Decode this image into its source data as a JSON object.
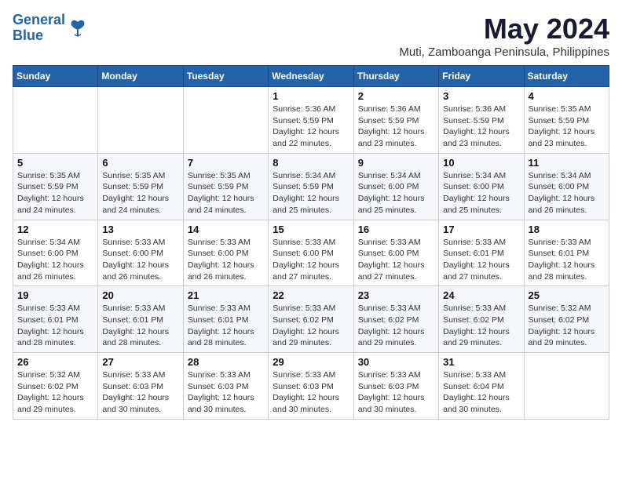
{
  "header": {
    "logo_line1": "General",
    "logo_line2": "Blue",
    "month": "May 2024",
    "location": "Muti, Zamboanga Peninsula, Philippines"
  },
  "weekdays": [
    "Sunday",
    "Monday",
    "Tuesday",
    "Wednesday",
    "Thursday",
    "Friday",
    "Saturday"
  ],
  "weeks": [
    [
      {
        "day": "",
        "info": ""
      },
      {
        "day": "",
        "info": ""
      },
      {
        "day": "",
        "info": ""
      },
      {
        "day": "1",
        "info": "Sunrise: 5:36 AM\nSunset: 5:59 PM\nDaylight: 12 hours\nand 22 minutes."
      },
      {
        "day": "2",
        "info": "Sunrise: 5:36 AM\nSunset: 5:59 PM\nDaylight: 12 hours\nand 23 minutes."
      },
      {
        "day": "3",
        "info": "Sunrise: 5:36 AM\nSunset: 5:59 PM\nDaylight: 12 hours\nand 23 minutes."
      },
      {
        "day": "4",
        "info": "Sunrise: 5:35 AM\nSunset: 5:59 PM\nDaylight: 12 hours\nand 23 minutes."
      }
    ],
    [
      {
        "day": "5",
        "info": "Sunrise: 5:35 AM\nSunset: 5:59 PM\nDaylight: 12 hours\nand 24 minutes."
      },
      {
        "day": "6",
        "info": "Sunrise: 5:35 AM\nSunset: 5:59 PM\nDaylight: 12 hours\nand 24 minutes."
      },
      {
        "day": "7",
        "info": "Sunrise: 5:35 AM\nSunset: 5:59 PM\nDaylight: 12 hours\nand 24 minutes."
      },
      {
        "day": "8",
        "info": "Sunrise: 5:34 AM\nSunset: 5:59 PM\nDaylight: 12 hours\nand 25 minutes."
      },
      {
        "day": "9",
        "info": "Sunrise: 5:34 AM\nSunset: 6:00 PM\nDaylight: 12 hours\nand 25 minutes."
      },
      {
        "day": "10",
        "info": "Sunrise: 5:34 AM\nSunset: 6:00 PM\nDaylight: 12 hours\nand 25 minutes."
      },
      {
        "day": "11",
        "info": "Sunrise: 5:34 AM\nSunset: 6:00 PM\nDaylight: 12 hours\nand 26 minutes."
      }
    ],
    [
      {
        "day": "12",
        "info": "Sunrise: 5:34 AM\nSunset: 6:00 PM\nDaylight: 12 hours\nand 26 minutes."
      },
      {
        "day": "13",
        "info": "Sunrise: 5:33 AM\nSunset: 6:00 PM\nDaylight: 12 hours\nand 26 minutes."
      },
      {
        "day": "14",
        "info": "Sunrise: 5:33 AM\nSunset: 6:00 PM\nDaylight: 12 hours\nand 26 minutes."
      },
      {
        "day": "15",
        "info": "Sunrise: 5:33 AM\nSunset: 6:00 PM\nDaylight: 12 hours\nand 27 minutes."
      },
      {
        "day": "16",
        "info": "Sunrise: 5:33 AM\nSunset: 6:00 PM\nDaylight: 12 hours\nand 27 minutes."
      },
      {
        "day": "17",
        "info": "Sunrise: 5:33 AM\nSunset: 6:01 PM\nDaylight: 12 hours\nand 27 minutes."
      },
      {
        "day": "18",
        "info": "Sunrise: 5:33 AM\nSunset: 6:01 PM\nDaylight: 12 hours\nand 28 minutes."
      }
    ],
    [
      {
        "day": "19",
        "info": "Sunrise: 5:33 AM\nSunset: 6:01 PM\nDaylight: 12 hours\nand 28 minutes."
      },
      {
        "day": "20",
        "info": "Sunrise: 5:33 AM\nSunset: 6:01 PM\nDaylight: 12 hours\nand 28 minutes."
      },
      {
        "day": "21",
        "info": "Sunrise: 5:33 AM\nSunset: 6:01 PM\nDaylight: 12 hours\nand 28 minutes."
      },
      {
        "day": "22",
        "info": "Sunrise: 5:33 AM\nSunset: 6:02 PM\nDaylight: 12 hours\nand 29 minutes."
      },
      {
        "day": "23",
        "info": "Sunrise: 5:33 AM\nSunset: 6:02 PM\nDaylight: 12 hours\nand 29 minutes."
      },
      {
        "day": "24",
        "info": "Sunrise: 5:33 AM\nSunset: 6:02 PM\nDaylight: 12 hours\nand 29 minutes."
      },
      {
        "day": "25",
        "info": "Sunrise: 5:32 AM\nSunset: 6:02 PM\nDaylight: 12 hours\nand 29 minutes."
      }
    ],
    [
      {
        "day": "26",
        "info": "Sunrise: 5:32 AM\nSunset: 6:02 PM\nDaylight: 12 hours\nand 29 minutes."
      },
      {
        "day": "27",
        "info": "Sunrise: 5:33 AM\nSunset: 6:03 PM\nDaylight: 12 hours\nand 30 minutes."
      },
      {
        "day": "28",
        "info": "Sunrise: 5:33 AM\nSunset: 6:03 PM\nDaylight: 12 hours\nand 30 minutes."
      },
      {
        "day": "29",
        "info": "Sunrise: 5:33 AM\nSunset: 6:03 PM\nDaylight: 12 hours\nand 30 minutes."
      },
      {
        "day": "30",
        "info": "Sunrise: 5:33 AM\nSunset: 6:03 PM\nDaylight: 12 hours\nand 30 minutes."
      },
      {
        "day": "31",
        "info": "Sunrise: 5:33 AM\nSunset: 6:04 PM\nDaylight: 12 hours\nand 30 minutes."
      },
      {
        "day": "",
        "info": ""
      }
    ]
  ]
}
